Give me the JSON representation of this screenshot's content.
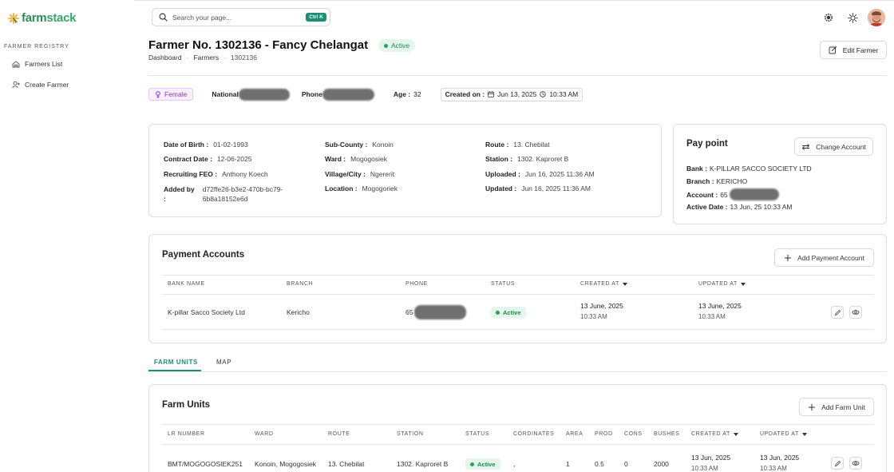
{
  "app": {
    "logo_text_a": "farm",
    "logo_text_b": "stack"
  },
  "sidebar": {
    "section": "FARMER REGISTRY",
    "items": [
      {
        "label": "Farmers List",
        "icon": "farm-icon"
      },
      {
        "label": "Create Farmer",
        "icon": "user-plus-icon"
      }
    ]
  },
  "topbar": {
    "search_placeholder": "Search your page...",
    "shortcut": "Ctrl K"
  },
  "header": {
    "title": "Farmer No. 1302136 - Fancy Chelangat",
    "status": "Active",
    "breadcrumb": [
      "Dashboard",
      "Farmers",
      "1302136"
    ],
    "edit_label": "Edit Farmer"
  },
  "info": {
    "gender": "Female",
    "national_label": "National",
    "phone_label": "Phone",
    "age_label": "Age :",
    "age_value": "32",
    "created_label": "Created on :",
    "created_date": "Jun 13, 2025",
    "created_time": "10:33 AM"
  },
  "details": {
    "col1": [
      {
        "k": "Date of Birth :",
        "v": "01-02-1993"
      },
      {
        "k": "Contract Date :",
        "v": "12-06-2025"
      },
      {
        "k": "Recruiting FEO :",
        "v": "Anthony Koech"
      },
      {
        "k": "Added by",
        "k2": ":",
        "v": "d72ffe26-b3e2-470b-bc79-",
        "v2": "6b8a18152e6d"
      }
    ],
    "col2": [
      {
        "k": "Sub-County :",
        "v": "Konoin"
      },
      {
        "k": "Ward :",
        "v": "Mogogosiek"
      },
      {
        "k": "Village/City :",
        "v": "Ngererit"
      },
      {
        "k": "Location :",
        "v": "Mogogoriek"
      }
    ],
    "col3": [
      {
        "k": "Route :",
        "v": "13. Chebilat"
      },
      {
        "k": "Station :",
        "v": "1302. Kaproret B"
      },
      {
        "k": "Uploaded :",
        "v": "Jun 16, 2025 11:36 AM"
      },
      {
        "k": "Updated :",
        "v": "Jun 16, 2025 11:36 AM"
      }
    ]
  },
  "paypoint": {
    "title": "Pay point",
    "change_label": "Change Account",
    "bank_k": "Bank :",
    "bank_v": "K-PILLAR SACCO SOCIETY LTD",
    "branch_k": "Branch :",
    "branch_v": "KERICHO",
    "account_k": "Account :",
    "account_v": "65",
    "active_k": "Active Date :",
    "active_v": "13 Jun, 25 10:33 AM"
  },
  "payment_accounts": {
    "title": "Payment Accounts",
    "add_label": "Add Payment Account",
    "columns": [
      "BANK NAME",
      "BRANCH",
      "PHONE",
      "STATUS",
      "CREATED AT",
      "UPDATED AT"
    ],
    "rows": [
      {
        "bank": "K-pillar Sacco Society Ltd",
        "branch": "Kericho",
        "phone": "65",
        "status": "Active",
        "created_date": "13 June, 2025",
        "created_time": "10:33 AM",
        "updated_date": "13 June, 2025",
        "updated_time": "10:33 AM"
      }
    ]
  },
  "tabs": [
    "FARM UNITS",
    "MAP"
  ],
  "farm_units": {
    "title": "Farm Units",
    "add_label": "Add Farm Unit",
    "columns": [
      "LR NUMBER",
      "WARD",
      "ROUTE",
      "STATION",
      "STATUS",
      "CORDINATES",
      "AREA",
      "PROD",
      "CONS",
      "BUSHES",
      "CREATED AT",
      "UPDATED AT"
    ],
    "rows": [
      {
        "lr": "BMT/MOGOGOSIEK251",
        "ward": "Konoin, Mogogosiek",
        "route": "13. Chebilat",
        "station": "1302. Kaproret B",
        "status": "Active",
        "coords": ",",
        "area": "1",
        "prod": "0.5",
        "cons": "0",
        "bushes": "2000",
        "created_date": "13 Jun, 2025",
        "created_time": "10:33 AM",
        "updated_date": "13 Jun, 2025",
        "updated_time": "10:33 AM"
      }
    ]
  },
  "colors": {
    "accent": "#1a8f74",
    "active_green": "#23a55a",
    "brand_green": "#2e8b57"
  }
}
